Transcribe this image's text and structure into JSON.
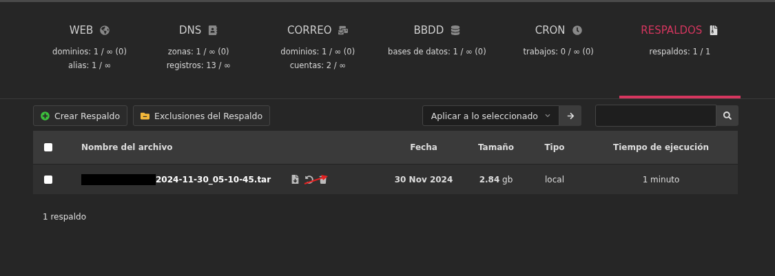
{
  "tabs": [
    {
      "label": "WEB",
      "selected": false,
      "stats": [
        "dominios: 1 / ∞ (0)",
        "alias: 1 / ∞"
      ]
    },
    {
      "label": "DNS",
      "selected": false,
      "stats": [
        "zonas: 1 / ∞ (0)",
        "registros: 13 / ∞"
      ]
    },
    {
      "label": "CORREO",
      "selected": false,
      "stats": [
        "dominios: 1 / ∞ (0)",
        "cuentas: 2 / ∞"
      ]
    },
    {
      "label": "BBDD",
      "selected": false,
      "stats": [
        "bases de datos: 1 / ∞ (0)"
      ]
    },
    {
      "label": "CRON",
      "selected": false,
      "stats": [
        "trabajos: 0 / ∞ (0)"
      ]
    },
    {
      "label": "RESPALDOS",
      "selected": true,
      "stats": [
        "respaldos: 1 / 1"
      ]
    }
  ],
  "toolbar": {
    "buttons": [
      "Crear Respaldo",
      "Exclusiones del Respaldo"
    ],
    "bulk_action": "Aplicar a lo seleccionado"
  },
  "table": {
    "select_all_checked": false,
    "columns": [
      "Nombre del archivo",
      "Fecha",
      "Tamaño",
      "Tipo",
      "Tiempo de ejecución"
    ],
    "rows": [
      {
        "checked": false,
        "name": "2024-11-30_05-10-45.tar",
        "date": "30 Nov 2024",
        "size": "**2.84** gb",
        "type": "local",
        "duration": "1 minuto"
      }
    ]
  },
  "footer": "1 respaldo"
}
